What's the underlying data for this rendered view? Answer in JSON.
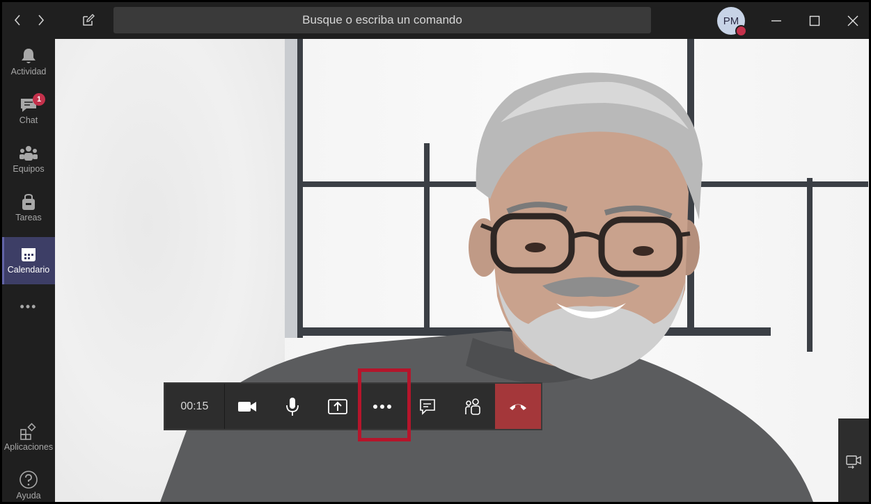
{
  "titlebar": {
    "search_placeholder": "Busque o escriba un comando",
    "avatar_initials": "PM"
  },
  "rail": {
    "items": [
      {
        "label": "Actividad",
        "icon": "bell-icon"
      },
      {
        "label": "Chat",
        "icon": "chat-icon",
        "badge": "1"
      },
      {
        "label": "Equipos",
        "icon": "teams-icon"
      },
      {
        "label": "Tareas",
        "icon": "tasks-icon"
      },
      {
        "label": "Calendario",
        "icon": "calendar-icon",
        "active": true
      }
    ],
    "more_label": "•••",
    "apps_label": "Aplicaciones",
    "help_label": "Ayuda"
  },
  "callbar": {
    "timer": "00:15",
    "buttons": [
      "video-camera",
      "microphone",
      "share-screen",
      "more-options",
      "chat",
      "participants",
      "hang-up"
    ]
  },
  "colors": {
    "accent": "#6264a7",
    "hangup": "#a4373a",
    "highlight": "#b5152b",
    "badge": "#c4314b"
  }
}
